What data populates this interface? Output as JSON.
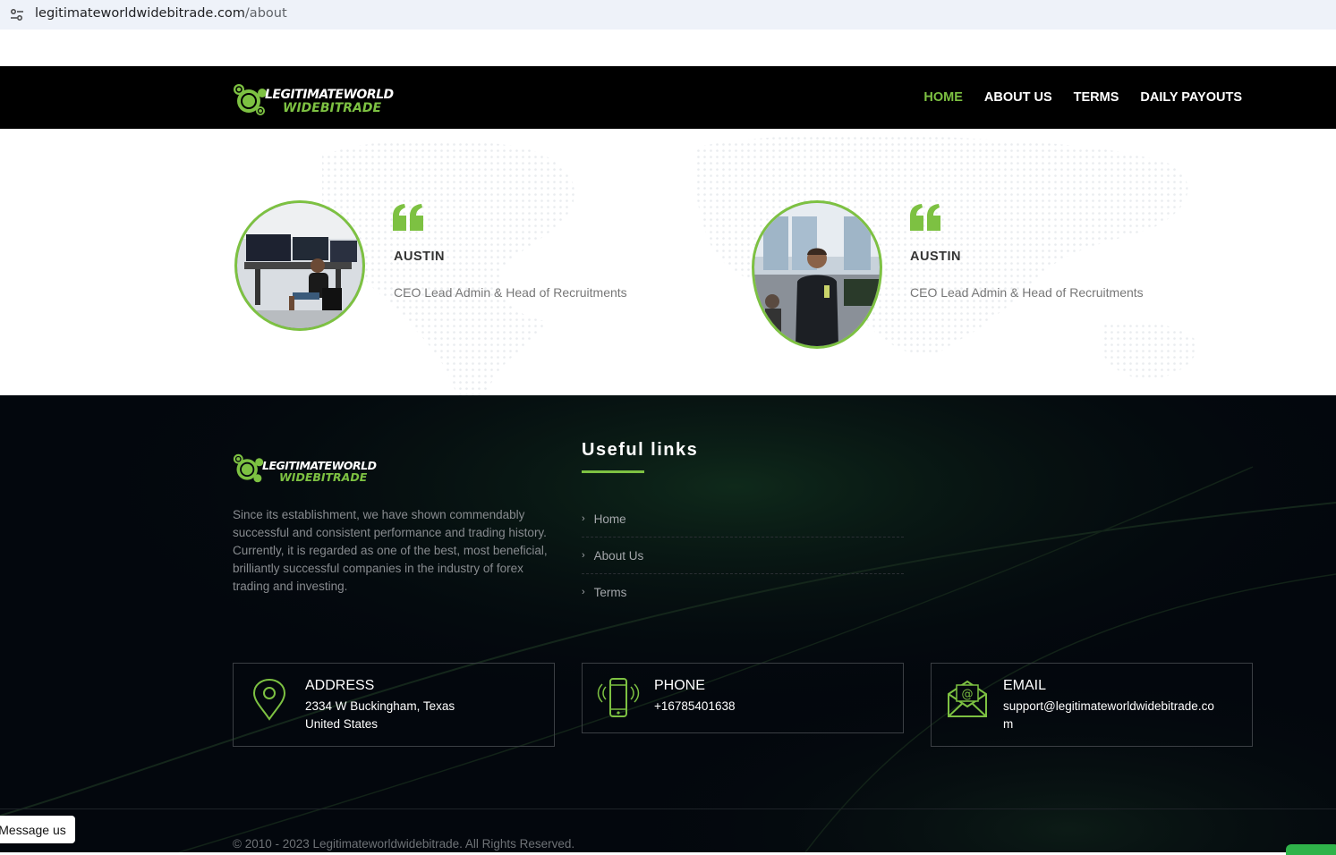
{
  "browser": {
    "url_host": "legitimateworldwidebitrade.com",
    "url_path": "/about",
    "site_info_icon": "tune-icon"
  },
  "brand": {
    "logo_line1": "LEGITIMATEWORLD",
    "logo_line2": "WIDEBITRADE",
    "accent_color": "#7dc142"
  },
  "nav": {
    "items": [
      {
        "label": "HOME",
        "active": true
      },
      {
        "label": "ABOUT US"
      },
      {
        "label": "TERMS"
      },
      {
        "label": "DAILY PAYOUTS"
      }
    ]
  },
  "team": {
    "members": [
      {
        "name": "AUSTIN",
        "role": "CEO Lead Admin & Head of Recruitments",
        "quote_icon": "quote-icon"
      },
      {
        "name": "AUSTIN",
        "role": "CEO Lead Admin & Head of Recruitments",
        "quote_icon": "quote-icon"
      }
    ]
  },
  "footer": {
    "description": "Since its establishment, we have shown commendably successful and consistent performance and trading history. Currently, it is regarded as one of the best, most beneficial, brilliantly successful companies in the industry of forex trading and investing.",
    "useful_links_title": "Useful links",
    "links": [
      {
        "label": "Home"
      },
      {
        "label": "About Us"
      },
      {
        "label": "Terms"
      }
    ],
    "contacts": {
      "address": {
        "title": "ADDRESS",
        "line1": "2334 W Buckingham, Texas",
        "line2": "United States",
        "icon": "location-pin-icon"
      },
      "phone": {
        "title": "PHONE",
        "value": "+16785401638",
        "icon": "phone-icon"
      },
      "email": {
        "title": "EMAIL",
        "line1": "support@legitimateworldwidebitrade.co",
        "line2": "m",
        "icon": "envelope-icon"
      }
    },
    "copyright": "© 2010 - 2023 Legitimateworldwidebitrade. All Rights Reserved."
  },
  "widgets": {
    "message_us": "Message us"
  }
}
